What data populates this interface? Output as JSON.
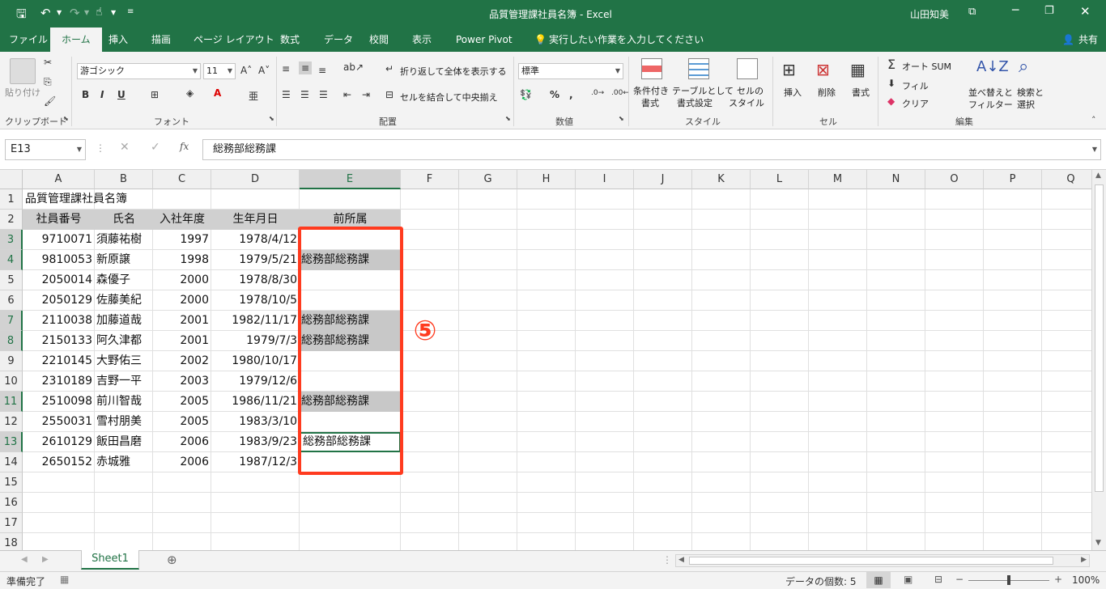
{
  "titlebar": {
    "title": "品質管理課社員名簿 - Excel",
    "user": "山田知美"
  },
  "tabs": [
    "ファイル",
    "ホーム",
    "挿入",
    "描画",
    "ページ レイアウト",
    "数式",
    "データ",
    "校閲",
    "表示",
    "Power Pivot"
  ],
  "active_tab": "ホーム",
  "tell_me": "実行したい作業を入力してください",
  "share": "共有",
  "ribbon": {
    "paste": "貼り付け",
    "clipboard": "クリップボード",
    "font_name": "游ゴシック",
    "font_size": "11",
    "font_group": "フォント",
    "wrap_text": "折り返して全体を表示する",
    "merge_center": "セルを結合して中央揃え",
    "alignment_group": "配置",
    "number_format": "標準",
    "number_group": "数値",
    "cond_format_1": "条件付き",
    "cond_format_2": "書式",
    "format_table_1": "テーブルとして",
    "format_table_2": "書式設定",
    "cell_style_1": "セルの",
    "cell_style_2": "スタイル",
    "styles_group": "スタイル",
    "insert": "挿入",
    "delete": "削除",
    "format": "書式",
    "cells_group": "セル",
    "autosum": "オート SUM",
    "fill": "フィル",
    "clear": "クリア",
    "sort_1": "並べ替えと",
    "sort_2": "フィルター",
    "find_1": "検索と",
    "find_2": "選択",
    "editing_group": "編集"
  },
  "formula_bar": {
    "name_box": "E13",
    "formula": "総務部総務課"
  },
  "columns": [
    "A",
    "B",
    "C",
    "D",
    "E",
    "F",
    "G",
    "H",
    "I",
    "J",
    "K",
    "L",
    "M",
    "N",
    "O",
    "P",
    "Q"
  ],
  "title_cell": "品質管理課社員名簿",
  "headers": [
    "社員番号",
    "氏名",
    "入社年度",
    "生年月日",
    "前所属"
  ],
  "rows": [
    {
      "id": "9710071",
      "name": "須藤祐樹",
      "year": "1997",
      "dob": "1978/4/12",
      "dept": ""
    },
    {
      "id": "9810053",
      "name": "新原譲",
      "year": "1998",
      "dob": "1979/5/21",
      "dept": "総務部総務課"
    },
    {
      "id": "2050014",
      "name": "森優子",
      "year": "2000",
      "dob": "1978/8/30",
      "dept": ""
    },
    {
      "id": "2050129",
      "name": "佐藤美紀",
      "year": "2000",
      "dob": "1978/10/5",
      "dept": ""
    },
    {
      "id": "2110038",
      "name": "加藤道哉",
      "year": "2001",
      "dob": "1982/11/17",
      "dept": "総務部総務課"
    },
    {
      "id": "2150133",
      "name": "阿久津都",
      "year": "2001",
      "dob": "1979/7/3",
      "dept": "総務部総務課"
    },
    {
      "id": "2210145",
      "name": "大野佑三",
      "year": "2002",
      "dob": "1980/10/17",
      "dept": ""
    },
    {
      "id": "2310189",
      "name": "吉野一平",
      "year": "2003",
      "dob": "1979/12/6",
      "dept": ""
    },
    {
      "id": "2510098",
      "name": "前川智哉",
      "year": "2005",
      "dob": "1986/11/21",
      "dept": "総務部総務課"
    },
    {
      "id": "2550031",
      "name": "雪村朋美",
      "year": "2005",
      "dob": "1983/3/10",
      "dept": ""
    },
    {
      "id": "2610129",
      "name": "飯田昌磨",
      "year": "2006",
      "dob": "1983/9/23",
      "dept": "総務部総務課"
    },
    {
      "id": "2650152",
      "name": "赤城雅",
      "year": "2006",
      "dob": "1987/12/3",
      "dept": ""
    }
  ],
  "row_numbers": [
    "1",
    "2",
    "3",
    "4",
    "5",
    "6",
    "7",
    "8",
    "9",
    "10",
    "11",
    "12",
    "13",
    "14",
    "15",
    "16",
    "17",
    "18"
  ],
  "annotation": "⑤",
  "sheet_tab": "Sheet1",
  "status": {
    "ready": "準備完了",
    "count": "データの個数: 5",
    "zoom": "100%"
  },
  "colors": {
    "excel_green": "#217346",
    "highlight_box": "#ff3b1f",
    "selection_grey": "#c8c8c8"
  }
}
